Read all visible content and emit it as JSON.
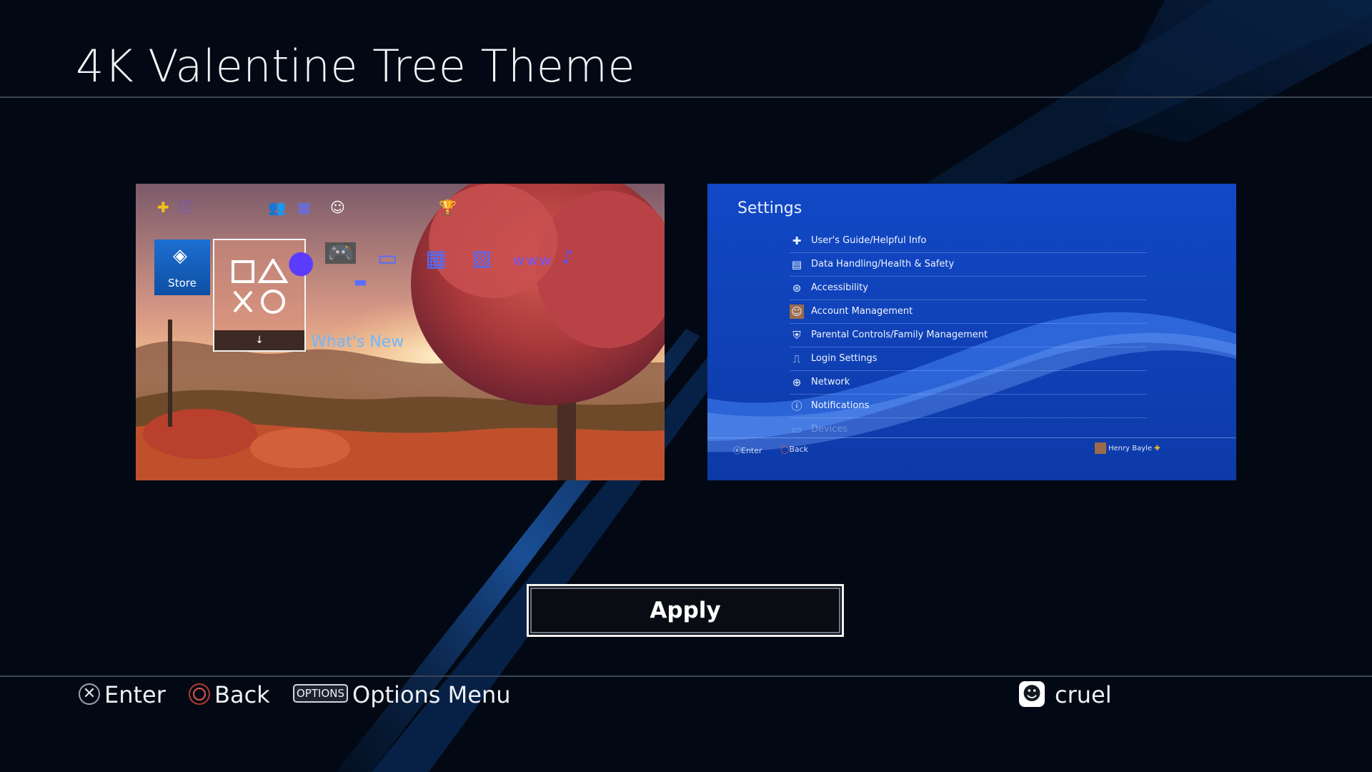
{
  "screen": {
    "title": "4K Valentine Tree Theme"
  },
  "home_preview": {
    "store_label": "Store",
    "whats_new_label": "What's New",
    "library_arrow": "↓"
  },
  "settings_preview": {
    "title": "Settings",
    "items": [
      {
        "label": "User's Guide/Helpful Info",
        "icon": "help-icon"
      },
      {
        "label": "Data Handling/Health & Safety",
        "icon": "data-icon"
      },
      {
        "label": "Accessibility",
        "icon": "accessibility-icon"
      },
      {
        "label": "Account Management",
        "icon": "account-icon"
      },
      {
        "label": "Parental Controls/Family Management",
        "icon": "shield-icon"
      },
      {
        "label": "Login Settings",
        "icon": "login-icon"
      },
      {
        "label": "Network",
        "icon": "globe-icon"
      },
      {
        "label": "Notifications",
        "icon": "info-icon"
      },
      {
        "label": "Devices",
        "icon": "devices-icon"
      }
    ],
    "footer": {
      "enter": "Enter",
      "back": "Back",
      "user": "Henry Bayle"
    }
  },
  "apply_button": {
    "label": "Apply"
  },
  "bottom_bar": {
    "enter": "Enter",
    "back": "Back",
    "options_badge": "OPTIONS",
    "options": "Options Menu",
    "user": "cruel"
  },
  "colors": {
    "background": "#020914",
    "accent_blue": "#1f5fbf",
    "settings_blue": "#1346c4"
  }
}
